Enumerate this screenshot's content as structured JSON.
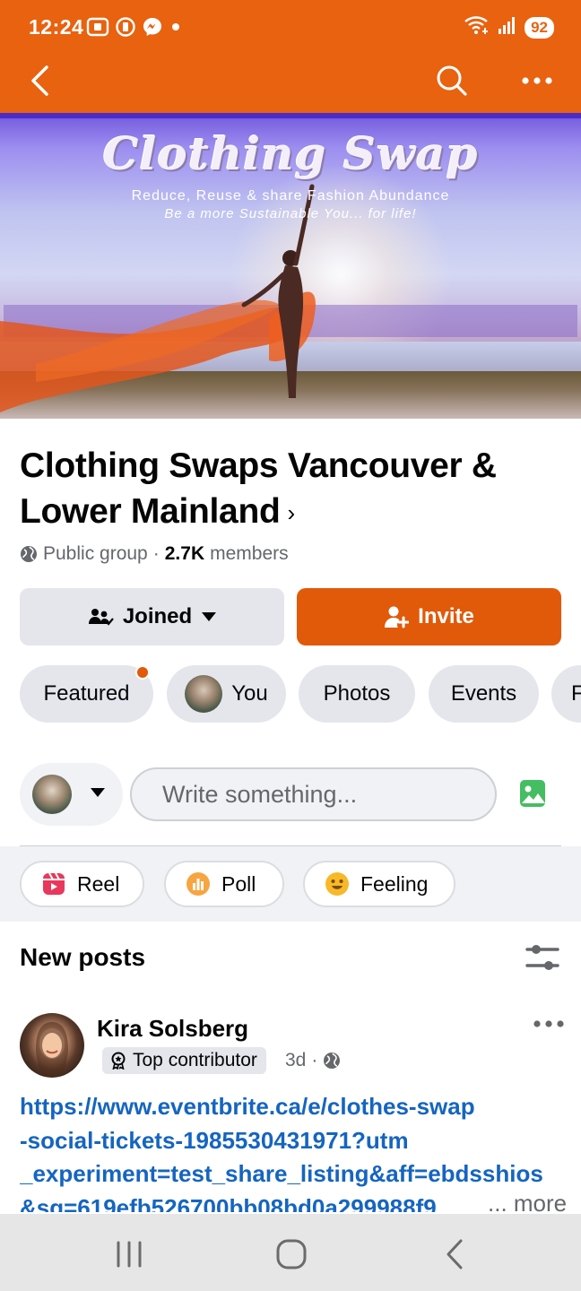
{
  "status_bar": {
    "time": "12:24",
    "battery": "92",
    "icons_left": [
      "screenshot-icon",
      "data-saver-icon",
      "messenger-icon",
      "dot-icon"
    ],
    "icons_right": [
      "wifi-icon",
      "signal-icon",
      "battery-icon"
    ]
  },
  "app_bar": {
    "icons": [
      "back-arrow-icon",
      "search-icon",
      "more-icon"
    ],
    "color": "#e8620f"
  },
  "cover": {
    "title": "Clothing Swap",
    "subtitle": "Reduce, Reuse & share Fashion Abundance",
    "tagline": "Be a more Sustainable You... for life!"
  },
  "group": {
    "name": "Clothing Swaps Vancouver & Lower Mainland",
    "chevron": "›",
    "privacy": "Public group",
    "separator": "·",
    "member_count": "2.7K",
    "members_label": "members"
  },
  "actions": {
    "joined_label": "Joined",
    "invite_label": "Invite",
    "accent_color": "#e05a0a"
  },
  "tabs": [
    {
      "label": "Featured",
      "has_dot": true
    },
    {
      "label": "You",
      "has_avatar": true
    },
    {
      "label": "Photos"
    },
    {
      "label": "Events"
    },
    {
      "label": "F"
    }
  ],
  "composer": {
    "placeholder": "Write something..."
  },
  "chips": [
    {
      "label": "Reel",
      "icon": "reel-icon"
    },
    {
      "label": "Poll",
      "icon": "poll-icon"
    },
    {
      "label": "Feeling",
      "icon": "feeling-icon"
    }
  ],
  "feed": {
    "section_title": "New posts",
    "post": {
      "author": "Kira Solsberg",
      "badge": "Top contributor",
      "time": "3d",
      "separator": "·",
      "link": "https://www.eventbrite.ca/e/clothes-swap-social-tickets-1985530431971?utm_experiment=test_share_listing&aff=ebdsshios&sg=619efb526700bb08bd0a299988f9",
      "link_lines": [
        "https://www.eventbrite.ca/e/clothes-swap",
        "-social-tickets-1985530431971?utm",
        "_experiment=test_share_listing&aff=ebdsshios",
        "&sg=619efb526700bb08bd0a299988f9"
      ],
      "more_label": "... more"
    }
  },
  "nav_bar": {
    "icons": [
      "recent-apps-icon",
      "home-icon",
      "back-icon"
    ]
  }
}
